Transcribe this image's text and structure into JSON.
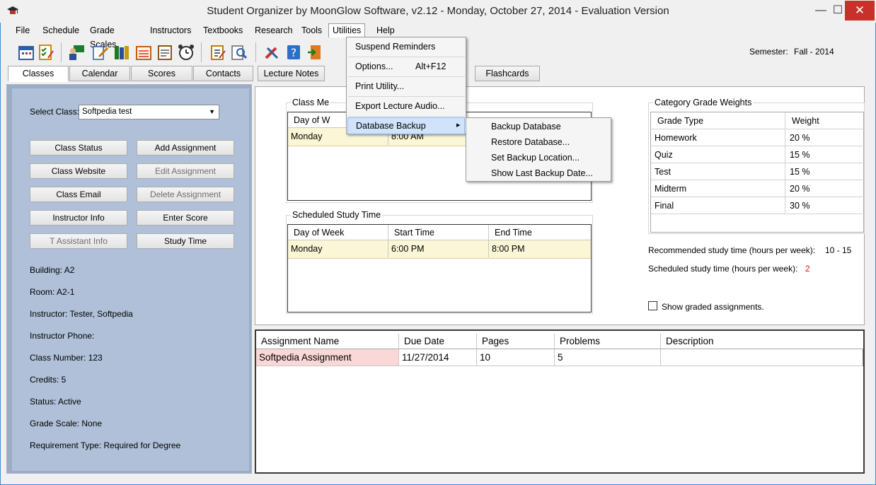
{
  "window": {
    "title": "Student Organizer by MoonGlow Software, v2.12  -  Monday, October 27, 2014  -  Evaluation Version",
    "min_glyph": "—",
    "max_glyph": "☐",
    "close_glyph": "✕"
  },
  "menubar": [
    "File",
    "Schedule",
    "Grade Scales",
    "Instructors",
    "Textbooks",
    "Research",
    "Tools",
    "Utilities",
    "Help"
  ],
  "toolbar": {
    "semester_label": "Semester:",
    "semester_value": "Fall - 2014",
    "icons": [
      "calendar-icon",
      "checklist-icon",
      "instructor-icon",
      "edit-icon",
      "books-icon",
      "schedule-icon",
      "notes-icon",
      "alarm-clock-icon",
      "notepad-icon",
      "research-icon",
      "tools-icon",
      "help-icon",
      "exit-icon"
    ]
  },
  "tabs": [
    "Classes",
    "Calendar",
    "Scores",
    "Contacts",
    "Lecture Notes",
    "Flashcards"
  ],
  "left": {
    "select_label": "Select Class:",
    "selected_class": "Softpedia test",
    "buttons": {
      "class_status": "Class Status",
      "add_assignment": "Add Assignment",
      "class_website": "Class Website",
      "edit_assignment": "Edit Assignment",
      "class_email": "Class Email",
      "delete_assignment": "Delete Assignment",
      "instructor_info": "Instructor Info",
      "enter_score": "Enter Score",
      "ta_info": "T Assistant Info",
      "study_time": "Study Time"
    },
    "info": [
      "Building:  A2",
      "Room:  A2-1",
      "Instructor:  Tester,  Softpedia",
      "Instructor Phone:",
      "Class Number:  123",
      "Credits:  5",
      "Status:  Active",
      "Grade Scale:  None",
      "Requirement Type:  Required for Degree"
    ]
  },
  "meetings": {
    "title": "Class Me",
    "col1": "Day of W",
    "row_day": "Monday",
    "row_start": "8:00 AM"
  },
  "study": {
    "title": "Scheduled Study Time",
    "headers": [
      "Day of Week",
      "Start Time",
      "End Time"
    ],
    "row": [
      "Monday",
      "6:00 PM",
      "8:00 PM"
    ]
  },
  "weights": {
    "title": "Category Grade Weights",
    "headers": [
      "Grade Type",
      "Weight"
    ],
    "rows": [
      [
        "Homework",
        "20 %"
      ],
      [
        "Quiz",
        "15 %"
      ],
      [
        "Test",
        "15 %"
      ],
      [
        "Midterm",
        "20 %"
      ],
      [
        "Final",
        "30 %"
      ]
    ]
  },
  "study_stats": {
    "recommended_label": "Recommended study time (hours per week):",
    "recommended_value": "10 - 15",
    "scheduled_label": "Scheduled study time (hours per week):",
    "scheduled_value": "2",
    "show_graded": "Show graded assignments."
  },
  "assignments": {
    "headers": [
      "Assignment Name",
      "Due Date",
      "Pages",
      "Problems",
      "Description"
    ],
    "rows": [
      [
        "Softpedia Assignment",
        "11/27/2014",
        "10",
        "5",
        ""
      ]
    ]
  },
  "utilities_menu": {
    "suspend": "Suspend Reminders",
    "options": "Options...",
    "options_shortcut": "Alt+F12",
    "print": "Print Utility...",
    "export": "Export Lecture Audio...",
    "backup": "Database Backup",
    "arrow": "▶"
  },
  "backup_submenu": [
    "Backup Database",
    "Restore Database...",
    "Set Backup Location...",
    "Show Last Backup Date..."
  ],
  "colors": {
    "selected_row": "#fbf6d6",
    "assignment_row": "#fbd8d8",
    "left_panel": "#afc0d8",
    "highlight": "#d1e3fa"
  }
}
